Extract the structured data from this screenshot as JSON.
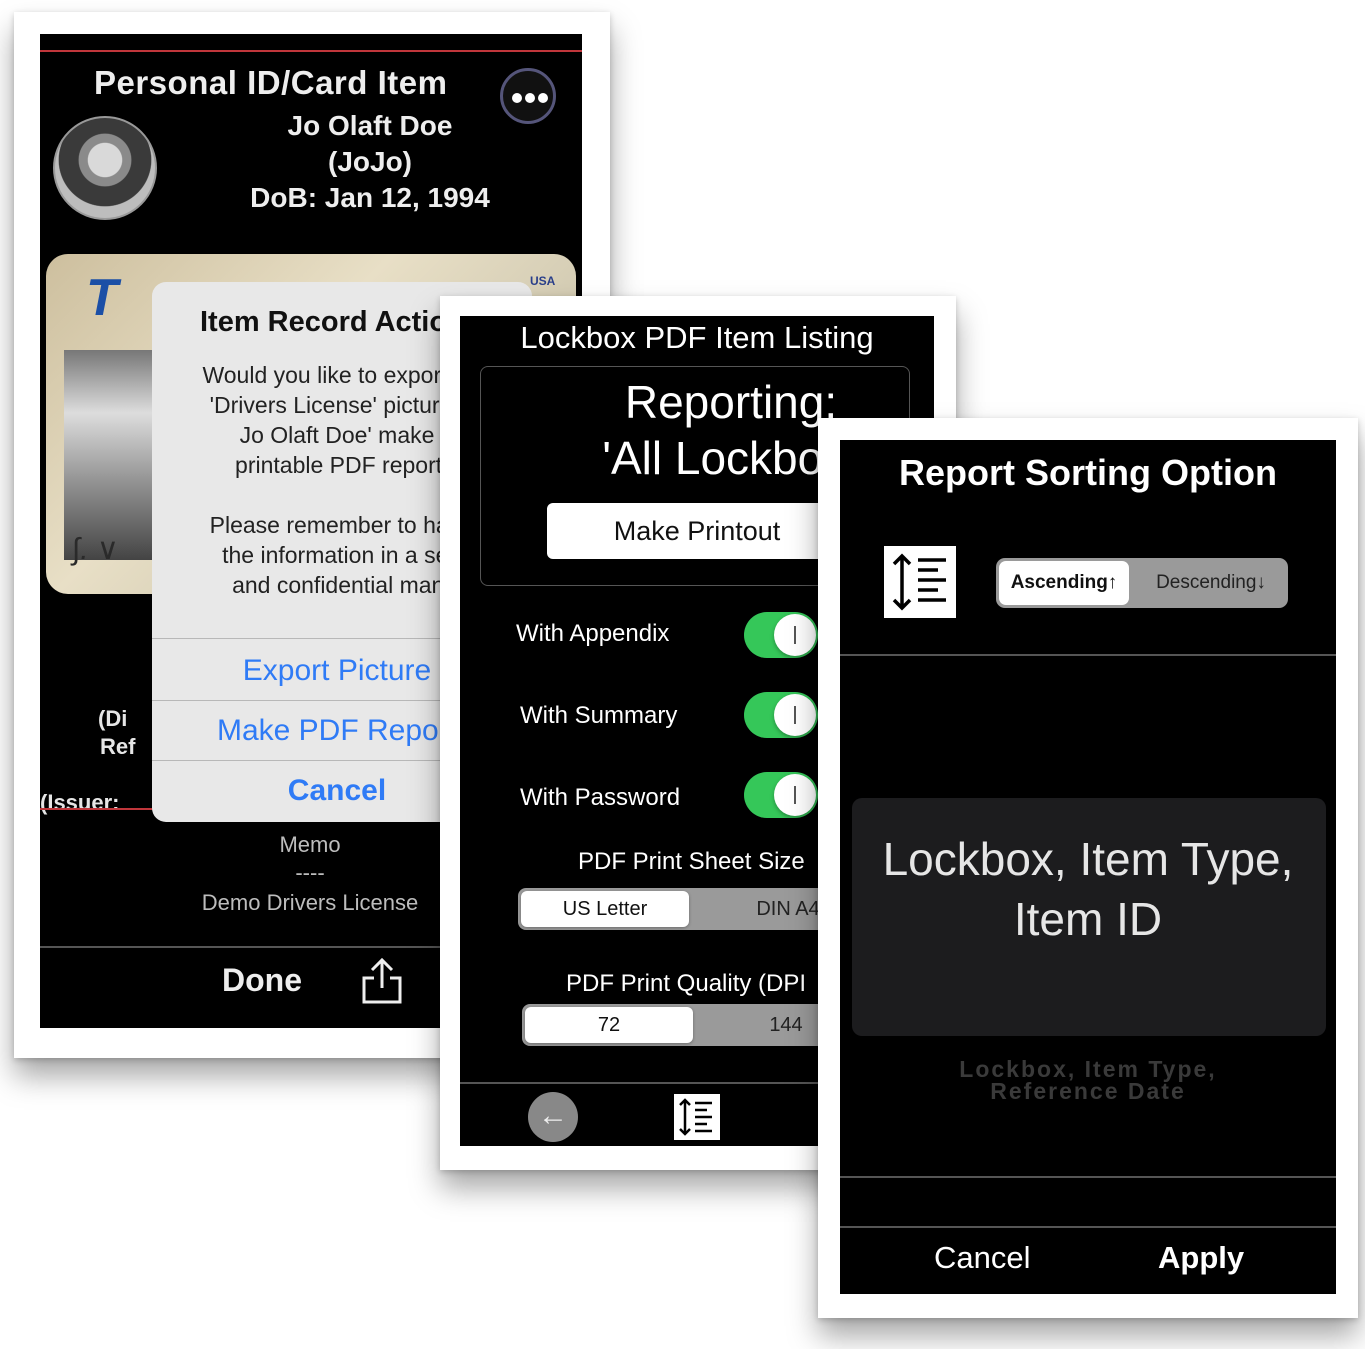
{
  "card1": {
    "title": "Personal ID/Card Item",
    "more_icon": "ellipsis-icon",
    "name_line1": "Jo Olaft Doe",
    "name_line2": "(JoJo)",
    "dob": "DoB: Jan 12, 1994",
    "partial_left1": "(Di",
    "partial_left2": "Ref",
    "issuer_partial": "(Issuer:",
    "memo_label": "Memo",
    "memo_sep": "----",
    "memo_text": "Demo Drivers License",
    "done_label": "Done",
    "share_icon": "share-icon",
    "alert": {
      "title": "Item Record Actio",
      "msg_lines": [
        "Would you like to export",
        "'Drivers License' picture",
        "Jo  Olaft Doe'     make",
        "printable PDF report?",
        "",
        "Please remember to har",
        "the information in a sec",
        "and confidential manne"
      ],
      "btn_export": "Export Picture",
      "btn_pdf": "Make PDF Report",
      "btn_cancel": "Cancel"
    }
  },
  "card2": {
    "title": "Lockbox PDF Item Listing",
    "reporting_line1": "Reporting:",
    "reporting_line2": "'All Lockboxe",
    "make_printout": "Make Printout",
    "toggles": [
      {
        "label": "With Appendix",
        "on": true
      },
      {
        "label": "With Summary",
        "on": true
      },
      {
        "label": "With Password",
        "on": true
      }
    ],
    "sheet_size_label": "PDF Print Sheet Size",
    "sheet_options": [
      "US Letter",
      "DIN A4"
    ],
    "sheet_selected": "US Letter",
    "quality_label": "PDF Print Quality (DPI",
    "quality_options": [
      "72",
      "144"
    ],
    "quality_selected": "72",
    "back_icon": "arrow-left-icon",
    "sort_icon": "sort-order-icon",
    "toggle_color": "#35c759"
  },
  "card3": {
    "title": "Report Sorting Option",
    "sort_icon": "sort-order-icon",
    "order_options": [
      "Ascending↑",
      "Descending↓"
    ],
    "order_selected": "Ascending↑",
    "picker_selected_line1": "Lockbox, Item Type,",
    "picker_selected_line2": "Item ID",
    "picker_next_line1": "Lockbox, Item Type,",
    "picker_next_line2": "Reference Date",
    "cancel_label": "Cancel",
    "apply_label": "Apply"
  }
}
